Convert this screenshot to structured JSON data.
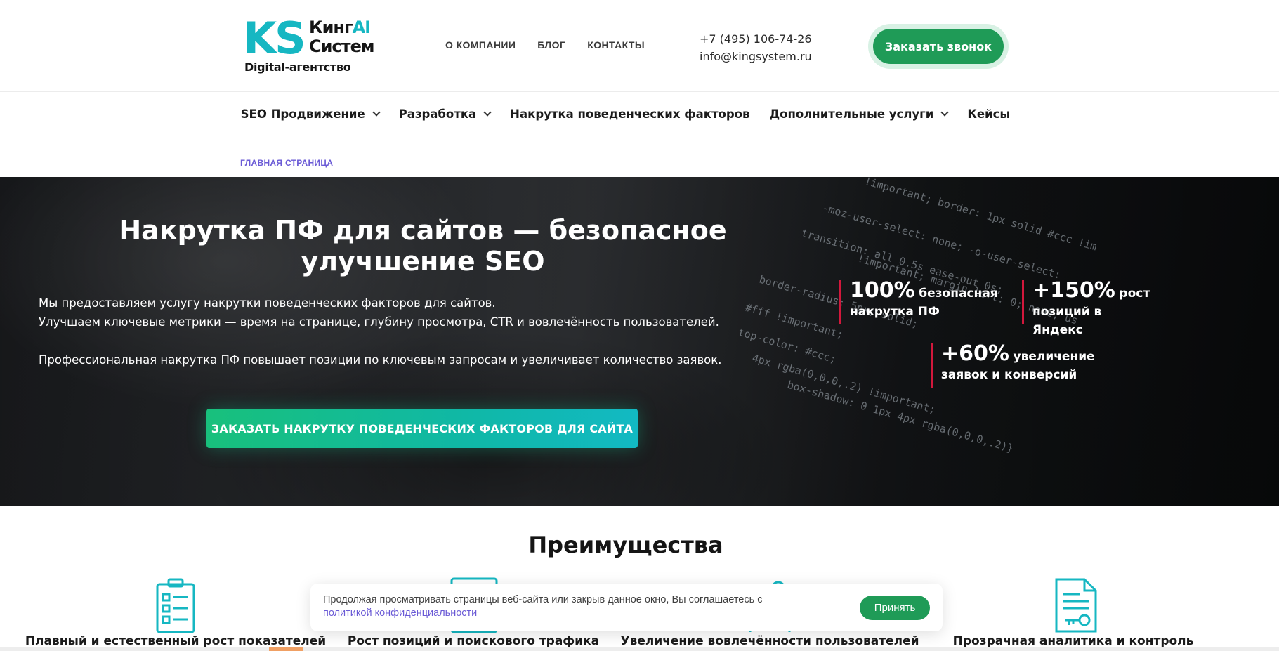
{
  "header": {
    "logo": {
      "mark": "KS",
      "name_line1": "Кинг",
      "name_ai": "AI",
      "name_line2": "Систем",
      "tagline": "Digital-агентство"
    },
    "top_nav": [
      "О КОМПАНИИ",
      "БЛОГ",
      "КОНТАКТЫ"
    ],
    "phone": "+7 (495) 106-74-26",
    "email": "info@kingsystem.ru",
    "call_button": "Заказать звонок"
  },
  "main_nav": [
    {
      "label": "SEO Продвижение",
      "dropdown": true
    },
    {
      "label": "Разработка",
      "dropdown": true
    },
    {
      "label": "Накрутка поведенческих факторов",
      "dropdown": false
    },
    {
      "label": "Дополнительные услуги",
      "dropdown": true
    },
    {
      "label": "Кейсы",
      "dropdown": false
    }
  ],
  "breadcrumb": "ГЛАВНАЯ СТРАНИЦА",
  "hero": {
    "title": "Накрутка ПФ для сайтов — безопасное улучшение SEO",
    "text_line1": "Мы предоставляем услугу накрутки поведенческих факторов для сайтов.",
    "text_line2": "Улучшаем ключевые метрики — время на странице, глубину просмотра, CTR и вовлечённость пользователей.",
    "text_line3": "Профессиональная накрутка ПФ повышает позиции по ключевым запросам и увеличивает количество заявок.",
    "cta": "ЗАКАЗАТЬ НАКРУТКУ ПОВЕДЕНЧЕСКИХ ФАКТОРОВ ДЛЯ САЙТА",
    "stats": [
      {
        "value": "100%",
        "text_a": "безопасная",
        "text_b": "накрутка ПФ"
      },
      {
        "value": "+150%",
        "text_a": "рост позиций в",
        "text_b": "Яндекс"
      },
      {
        "value": "+60%",
        "text_a": "увеличение",
        "text_b": "заявок и конверсий"
      }
    ],
    "code_lines": [
      "!important; border: 1px solid #ccc !im",
      "-moz-user-select: none; -o-user-select:",
      "transition: all 0.5s ease-out 0s;",
      "!important; margin-left: 0; none; us",
      "border-radius: 5px; solid;",
      "#fff !important;",
      "top-color: #ccc;",
      "4px rgba(0,0,0,.2) !important;",
      "box-shadow: 0 1px 4px rgba(0,0,0,.2)}"
    ]
  },
  "advantages": {
    "title": "Преимущества",
    "items": [
      "Плавный и естественный рост показателей",
      "Рост позиций и поискового трафика",
      "Увеличение вовлечённости пользователей",
      "Прозрачная аналитика и контроль"
    ]
  },
  "cookie": {
    "text": "Продолжая просматривать страницы веб-сайта или закрыв данное окно, Вы соглашаетесь с",
    "link": "политикой конфиденциальности",
    "accept": "Принять"
  },
  "colors": {
    "brand_teal": "#16b7c2",
    "green": "#1f9b57",
    "accent_red": "#d2183c",
    "breadcrumb": "#6b5bd6"
  }
}
